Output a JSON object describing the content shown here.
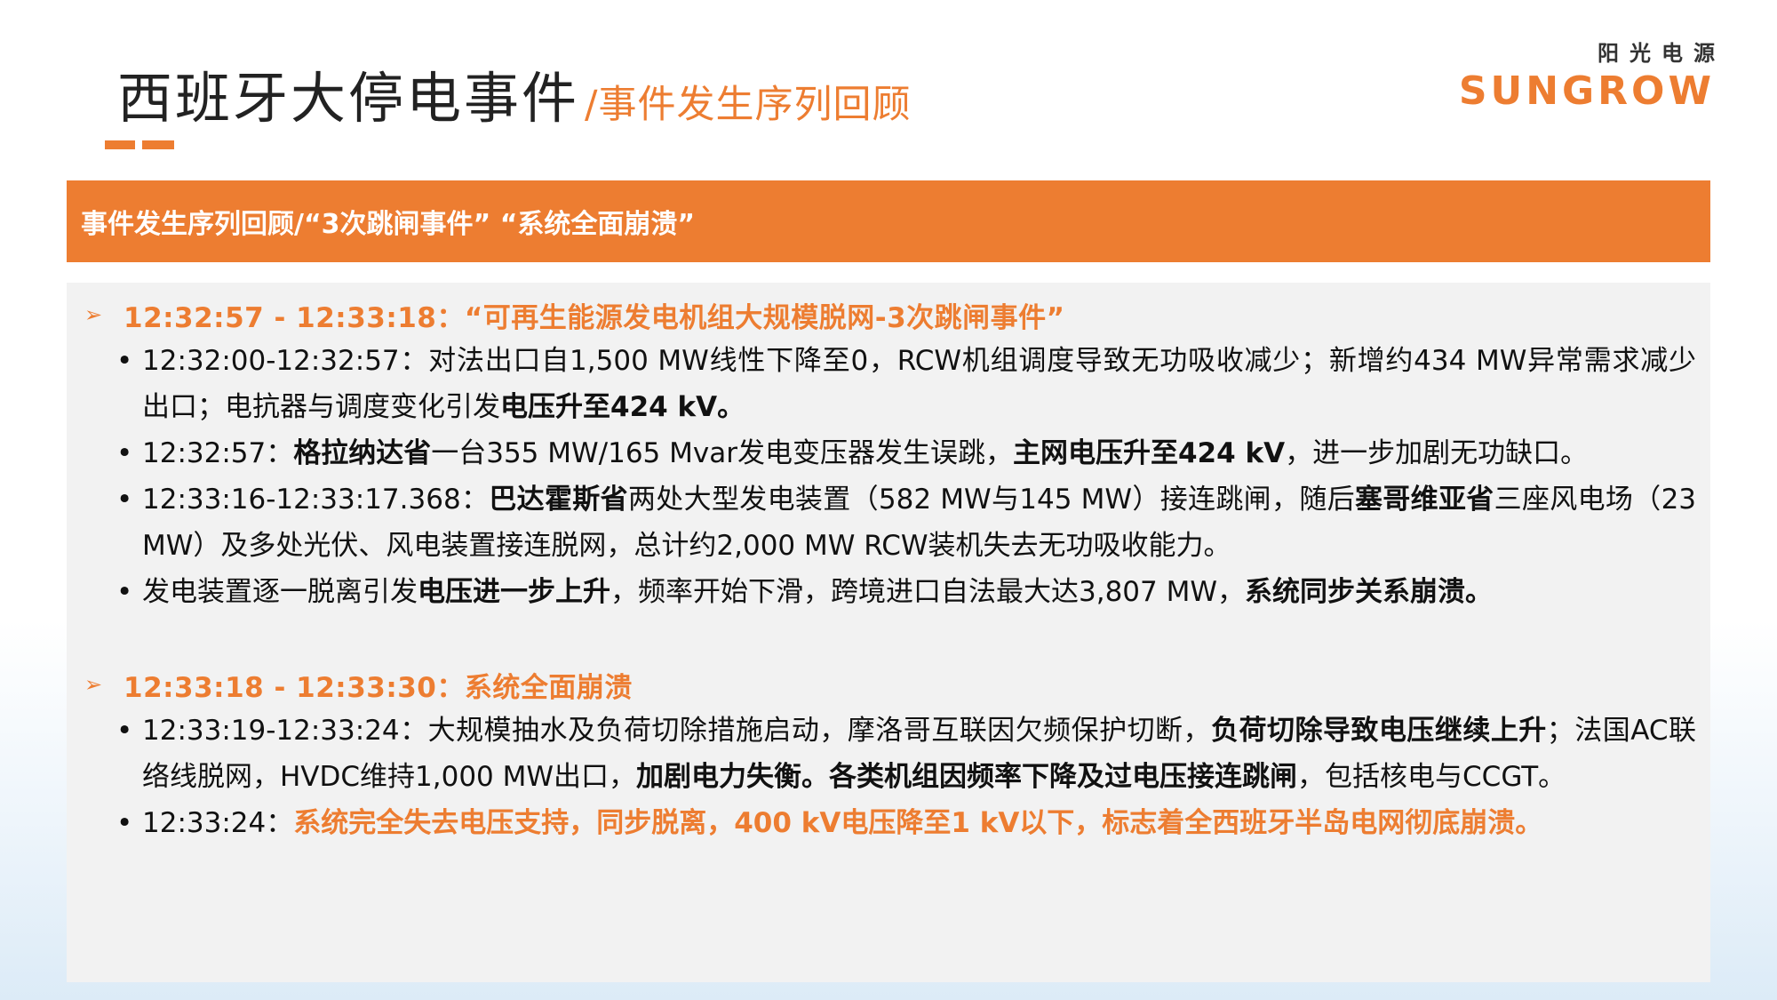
{
  "header": {
    "title": "西班牙大停电事件",
    "subtitle": "/事件发生序列回顾"
  },
  "logo": {
    "cn": "阳光电源",
    "en": "SUNGROW",
    "accent": "#ED7D31"
  },
  "banner": {
    "text": "事件发生序列回顾/“3次跳闸事件” “系统全面崩溃”"
  },
  "sections": [
    {
      "heading": "12:32:57 - 12:33:18：“可再生能源发电机组大规模脱网-3次跳闸事件”",
      "bullets": [
        {
          "parts": [
            {
              "t": "12:32:00-12:32:57：对法出口自1,500 MW线性下降至0，RCW机组调度导致无功吸收减少；新增约434 MW异常需求减少出口；电抗器与调度变化引发"
            },
            {
              "t": "电压升至424 kV。",
              "s": "b"
            }
          ]
        },
        {
          "parts": [
            {
              "t": "12:32:57："
            },
            {
              "t": "格拉纳达省",
              "s": "b"
            },
            {
              "t": "一台355 MW/165 Mvar发电变压器发生误跳，"
            },
            {
              "t": "主网电压升至424 kV",
              "s": "b"
            },
            {
              "t": "，进一步加剧无功缺口。"
            }
          ]
        },
        {
          "parts": [
            {
              "t": "12:33:16-12:33:17.368："
            },
            {
              "t": "巴达霍斯省",
              "s": "b"
            },
            {
              "t": "两处大型发电装置（582 MW与145 MW）接连跳闸，随后"
            },
            {
              "t": "塞哥维亚省",
              "s": "b"
            },
            {
              "t": "三座风电场（23 MW）及多处光伏、风电装置接连脱网，总计约2,000 MW RCW装机失去无功吸收能力。"
            }
          ]
        },
        {
          "parts": [
            {
              "t": "发电装置逐一脱离引发"
            },
            {
              "t": "电压进一步上升",
              "s": "b"
            },
            {
              "t": "，频率开始下滑，跨境进口自法最大达3,807 MW，"
            },
            {
              "t": "系统同步关系崩溃。",
              "s": "b"
            }
          ]
        }
      ]
    },
    {
      "heading": "12:33:18 - 12:33:30：系统全面崩溃",
      "bullets": [
        {
          "parts": [
            {
              "t": "12:33:19-12:33:24：大规模抽水及负荷切除措施启动，摩洛哥互联因欠频保护切断，"
            },
            {
              "t": "负荷切除导致电压继续上升",
              "s": "b"
            },
            {
              "t": "；法国AC联络线脱网，HVDC维持1,000 MW出口，"
            },
            {
              "t": "加剧电力失衡。各类机组因频率下降及过电压接连跳闸",
              "s": "b"
            },
            {
              "t": "，包括核电与CCGT。"
            }
          ]
        },
        {
          "parts": [
            {
              "t": "12:33:24："
            },
            {
              "t": "系统完全失去电压支持，同步脱离，400 kV电压降至1 kV以下，标志着全西班牙半岛电网彻底崩溃。",
              "s": "o"
            }
          ]
        }
      ]
    }
  ]
}
